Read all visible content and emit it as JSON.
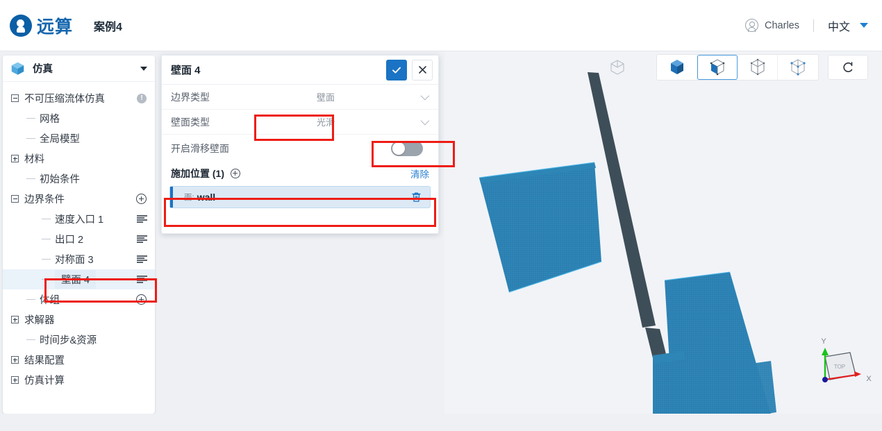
{
  "header": {
    "logo_text": "远算",
    "case_title": "案例4",
    "user_name": "Charles",
    "language": "中文",
    "avatar_icon": "user-avatar-icon",
    "caret_icon": "caret-down-icon"
  },
  "sidebar": {
    "panel_label": "仿真",
    "panel_icon": "cube-icon",
    "caret_icon": "caret-down-icon",
    "items": [
      {
        "label": "不可压缩流体仿真",
        "indent": 0,
        "expander": "minus",
        "trailing": "info"
      },
      {
        "label": "网格",
        "indent": 1,
        "expander": "none",
        "trailing": "none"
      },
      {
        "label": "全局模型",
        "indent": 1,
        "expander": "none",
        "trailing": "none"
      },
      {
        "label": "材料",
        "indent": 0,
        "expander": "plus",
        "trailing": "none"
      },
      {
        "label": "初始条件",
        "indent": 1,
        "expander": "none",
        "trailing": "none"
      },
      {
        "label": "边界条件",
        "indent": 0,
        "expander": "minus",
        "trailing": "plus"
      },
      {
        "label": "速度入口 1",
        "indent": 2,
        "expander": "none",
        "trailing": "menu"
      },
      {
        "label": "出口 2",
        "indent": 2,
        "expander": "none",
        "trailing": "menu"
      },
      {
        "label": "对称面 3",
        "indent": 2,
        "expander": "none",
        "trailing": "menu"
      },
      {
        "label": "壁面 4",
        "indent": 2,
        "expander": "none",
        "trailing": "menu",
        "selected": true
      },
      {
        "label": "体组",
        "indent": 1,
        "expander": "none",
        "trailing": "plus"
      },
      {
        "label": "求解器",
        "indent": 0,
        "expander": "plus",
        "trailing": "none"
      },
      {
        "label": "时间步&资源",
        "indent": 1,
        "expander": "none",
        "trailing": "none"
      },
      {
        "label": "结果配置",
        "indent": 0,
        "expander": "plus",
        "trailing": "none"
      },
      {
        "label": "仿真计算",
        "indent": 0,
        "expander": "plus",
        "trailing": "none"
      }
    ]
  },
  "dialog": {
    "title": "壁面 4",
    "confirm_icon": "check-icon",
    "close_icon": "close-icon",
    "fields": [
      {
        "label": "边界类型",
        "value": "壁面",
        "chevron_icon": "chevron-down-icon"
      },
      {
        "label": "壁面类型",
        "value": "光滑",
        "chevron_icon": "chevron-down-icon"
      }
    ],
    "toggle": {
      "label": "开启滑移壁面",
      "state": "off"
    },
    "section": {
      "title": "施加位置 (1)",
      "add_icon": "plus-circle-icon",
      "clear_label": "清除"
    },
    "assignments": [
      {
        "prefix": "面:",
        "name": "wall",
        "delete_icon": "trash-icon"
      }
    ]
  },
  "viewport": {
    "ghost_cube_icon": "cube-outline-icon",
    "view_buttons": [
      {
        "icon": "cube-solid-icon",
        "active": false
      },
      {
        "icon": "cube-half-icon",
        "active": true
      },
      {
        "icon": "cube-wireframe-icon",
        "active": false
      },
      {
        "icon": "cube-points-icon",
        "active": false
      }
    ],
    "reset_icon": "reset-rotate-icon",
    "axis": {
      "face_label": "TOP",
      "x_label": "X",
      "y_label": "Y",
      "x_color": "#e02020",
      "y_color": "#19c219",
      "origin_color": "#1a1a9e"
    },
    "model": {
      "mesh_color": "#2a7fb0",
      "edge_color": "#3e4e58",
      "background": "#f1f3f7"
    }
  },
  "annotations": {
    "highlight_color": "#ee1c15",
    "boxes": [
      {
        "name": "wall-type-value-highlight"
      },
      {
        "name": "slip-wall-toggle-highlight"
      },
      {
        "name": "assignment-item-highlight"
      },
      {
        "name": "sidebar-wall4-highlight"
      }
    ]
  }
}
